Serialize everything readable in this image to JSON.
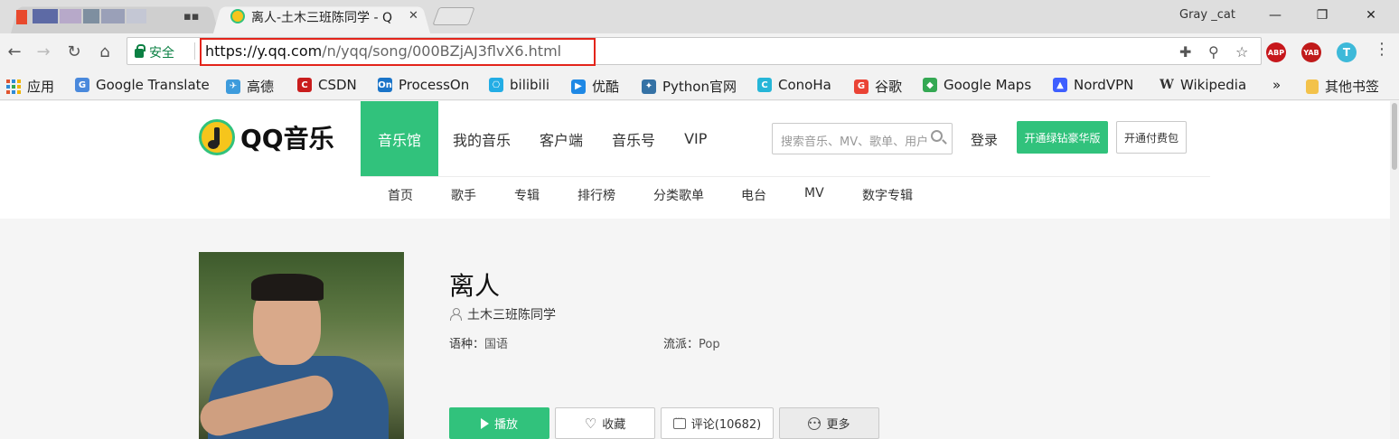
{
  "browser": {
    "user_name": "Gray _cat",
    "active_tab": {
      "title": "离人-土木三班陈同学 - Q"
    },
    "window_buttons": {
      "minimize": "—",
      "restore": "❐",
      "close": "✕"
    },
    "toolbar": {
      "secure_label": "安全",
      "url_scheme_host": "https://y.qq.com",
      "url_path": "/n/yqq/song/000BZjAJ3flvX6.html"
    },
    "extensions": [
      {
        "name": "ABP",
        "color": "#c7171c"
      },
      {
        "name": "YAB",
        "color": "#c01a1a"
      },
      {
        "name": "T",
        "color": "#3db9d9"
      }
    ],
    "bookmarks": [
      {
        "label": "应用",
        "icon": "apps-grid-icon"
      },
      {
        "label": "Google Translate",
        "icon": "google-translate-icon",
        "badge": "G",
        "color": "#4a89dc"
      },
      {
        "label": "高德",
        "icon": "amap-icon",
        "badge": "✈",
        "color": "#3d9bdc"
      },
      {
        "label": "CSDN",
        "icon": "csdn-icon",
        "badge": "C",
        "color": "#c91d1d"
      },
      {
        "label": "ProcessOn",
        "icon": "processon-icon",
        "badge": "On",
        "color": "#1a74c8"
      },
      {
        "label": "bilibili",
        "icon": "bilibili-icon",
        "badge": "⎔",
        "color": "#23ade5"
      },
      {
        "label": "优酷",
        "icon": "youku-icon",
        "badge": "▶",
        "color": "#1e88e5"
      },
      {
        "label": "Python官网",
        "icon": "python-icon",
        "badge": "✦",
        "color": "#3572a5"
      },
      {
        "label": "ConoHa",
        "icon": "conoha-icon",
        "badge": "C",
        "color": "#26b6d8"
      },
      {
        "label": "谷歌",
        "icon": "google-icon",
        "badge": "G",
        "color": "#ea4335"
      },
      {
        "label": "Google Maps",
        "icon": "google-maps-icon",
        "badge": "◆",
        "color": "#34a853"
      },
      {
        "label": "NordVPN",
        "icon": "nordvpn-icon",
        "badge": "▲",
        "color": "#3e5fff"
      },
      {
        "label": "Wikipedia",
        "icon": "wikipedia-icon",
        "badge": "W",
        "color": "#333333"
      }
    ],
    "bookmarks_overflow": "»",
    "other_bookmarks": "其他书签"
  },
  "site": {
    "logo_text": "QQ音乐",
    "main_nav": [
      "音乐馆",
      "我的音乐",
      "客户端",
      "音乐号",
      "VIP"
    ],
    "active_nav_index": 0,
    "search_placeholder": "搜索音乐、MV、歌单、用户",
    "login": "登录",
    "vip_button": "开通绿钻豪华版",
    "paid_button": "开通付费包",
    "sub_nav": [
      "首页",
      "歌手",
      "专辑",
      "排行榜",
      "分类歌单",
      "电台",
      "MV",
      "数字专辑"
    ]
  },
  "song": {
    "title": "离人",
    "singer": "土木三班陈同学",
    "language_label": "语种：",
    "language": "国语",
    "genre_label": "流派：",
    "genre": "Pop",
    "actions": {
      "play": "播放",
      "favorite": "收藏",
      "comments": "评论(10682)",
      "more": "更多"
    }
  },
  "colors": {
    "brand_green": "#31c27c",
    "highlight_red": "#e3241a",
    "secure_green": "#0b8043"
  }
}
